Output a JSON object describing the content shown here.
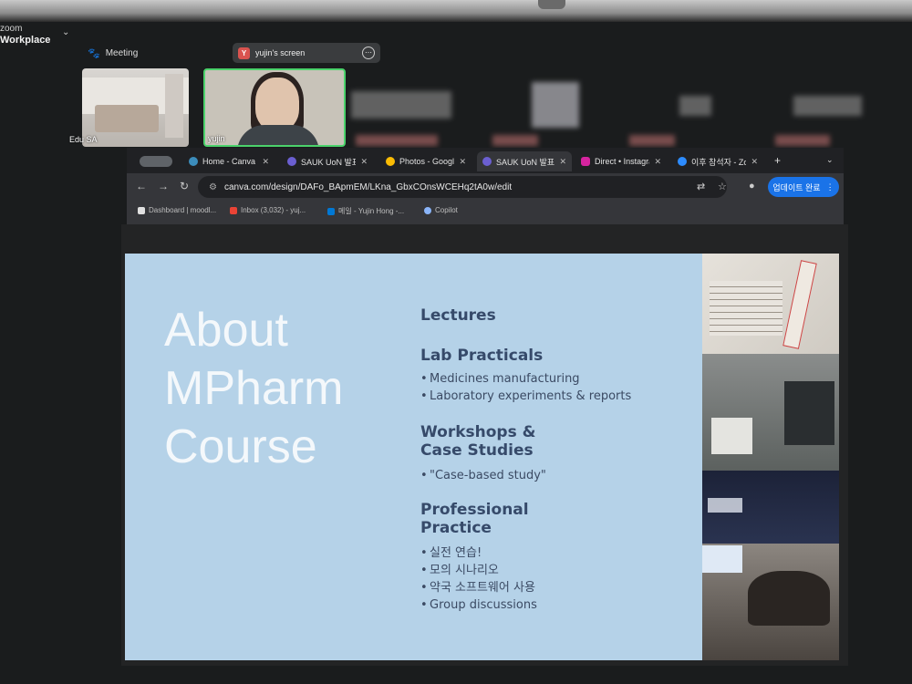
{
  "zoom": {
    "brand_line1": "zoom",
    "brand_line2": "Workplace",
    "meeting_label": "Meeting",
    "share_label": "yujin's screen",
    "share_badge": "Y",
    "participants": [
      {
        "name": "Edu SA"
      },
      {
        "name": "yujin"
      }
    ]
  },
  "browser": {
    "tabs": [
      {
        "label": "Home - Canva",
        "color": "#3c8dbc"
      },
      {
        "label": "SAUK UoN 발표",
        "color": "#6b5fd1"
      },
      {
        "label": "Photos - Google",
        "color": "#fbbc04"
      },
      {
        "label": "SAUK UoN 발표",
        "color": "#6b5fd1"
      },
      {
        "label": "Direct • Instagram",
        "color": "#d6249f"
      },
      {
        "label": "이후 참석자 - Zoom",
        "color": "#2d8cff"
      }
    ],
    "url": "canva.com/design/DAFo_BApmEM/LKna_GbxCOnsWCEHq2tA0w/edit",
    "update_button": "업데이트 완료",
    "bookmarks": [
      {
        "label": "Dashboard | moodl...",
        "color": "#e0e0e0"
      },
      {
        "label": "Inbox (3,032) - yuj...",
        "color": "#ea4335"
      },
      {
        "label": "메일 - Yujin Hong -...",
        "color": "#0078d4"
      },
      {
        "label": "Copilot",
        "color": "#8ab4f8"
      }
    ]
  },
  "slide": {
    "title_lines": [
      "About",
      "MPharm",
      "Course"
    ],
    "sections": [
      {
        "heading": "Lectures",
        "items": []
      },
      {
        "heading": "Lab Practicals",
        "items": [
          "Medicines manufacturing",
          "Laboratory experiments & reports"
        ]
      },
      {
        "heading": "Workshops & Case Studies",
        "items": [
          "\"Case-based study\""
        ]
      },
      {
        "heading": "Professional Practice",
        "items": [
          "실전 연습!",
          "모의 시나리오",
          "약국 소프트웨어 사용",
          "Group discussions"
        ]
      }
    ]
  }
}
